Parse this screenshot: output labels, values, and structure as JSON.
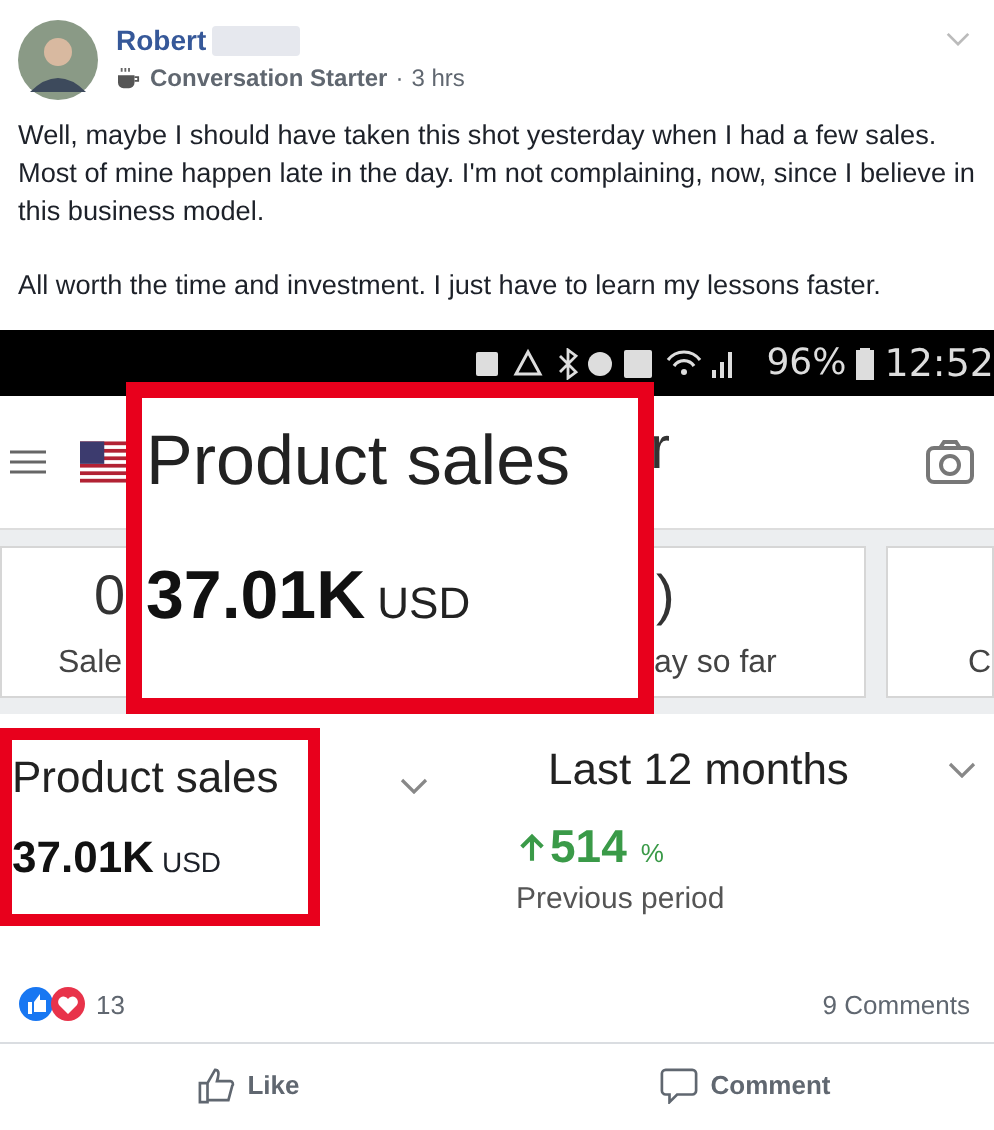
{
  "post": {
    "author": "Robert",
    "badge": "Conversation Starter",
    "separator": "·",
    "time": "3 hrs",
    "paragraphs": [
      "Well, maybe I should have taken this shot yesterday when I had a few sales. Most of mine happen late in the day. I'm not complaining, now, since I believe in this business model.",
      "All worth the time and investment. I just have to learn my lessons faster."
    ]
  },
  "screenshot": {
    "status_bar": {
      "battery": "96%",
      "time": "12:52"
    },
    "app_bar": {
      "title_fragment": "r"
    },
    "cards": [
      {
        "value": "0",
        "label": "Sale"
      },
      {
        "value": ")",
        "label": "ay so far"
      },
      {
        "label": "C"
      }
    ],
    "callout": {
      "title": "Product sales",
      "value": "37.01K",
      "unit": "USD"
    },
    "metric": {
      "title": "Product sales",
      "value": "37.01K",
      "unit": "USD"
    },
    "period": {
      "label": "Last 12 months",
      "change": "514",
      "unit": "%",
      "caption": "Previous period"
    }
  },
  "reactions": {
    "count": "13",
    "comments": "9 Comments"
  },
  "actions": [
    {
      "kind": "like",
      "label": "Like"
    },
    {
      "kind": "comment",
      "label": "Comment"
    }
  ]
}
